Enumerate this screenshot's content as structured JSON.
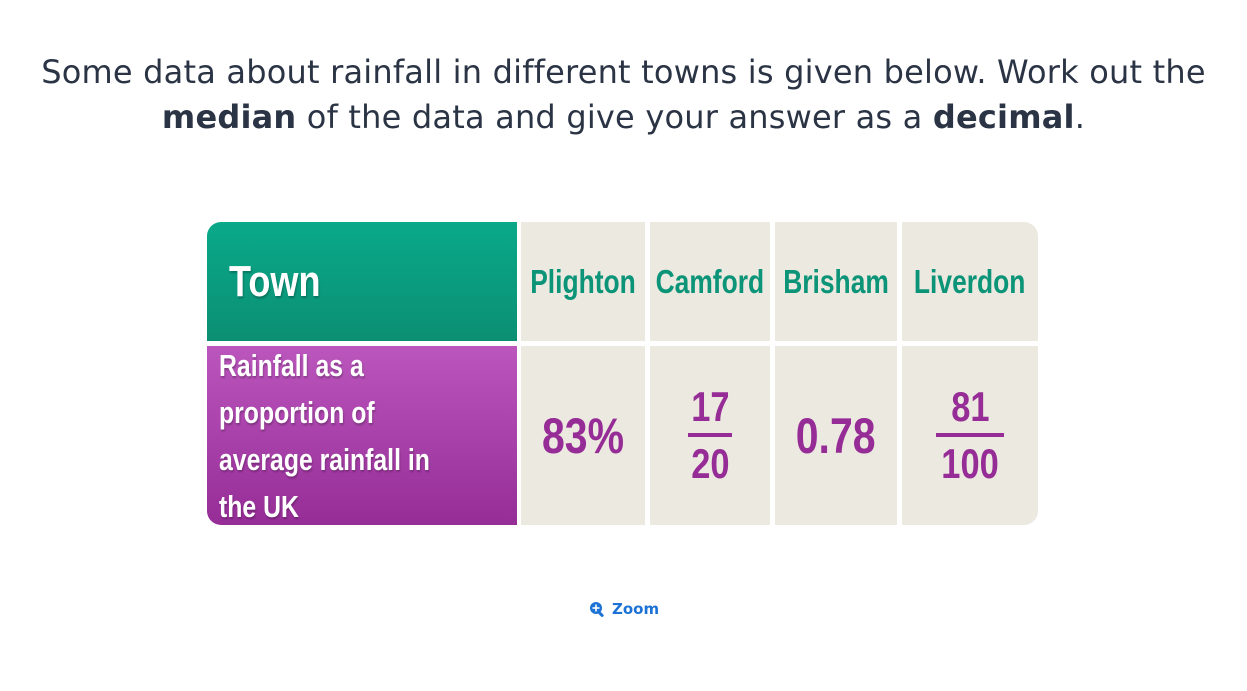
{
  "question": {
    "line1": "Some data about rainfall in different towns is given below. Work out the",
    "line2_bold1": "median",
    "line2_mid": " of the data and give your answer as a ",
    "line2_bold2": "decimal",
    "line2_end": "."
  },
  "table": {
    "header_label": "Town",
    "row_label": "Rainfall as a proportion of average rainfall in the UK",
    "towns": [
      "Plighton",
      "Camford",
      "Brisham",
      "Liverdon"
    ],
    "values": {
      "plighton": "83%",
      "camford_num": "17",
      "camford_den": "20",
      "brisham": "0.78",
      "liverdon_num": "81",
      "liverdon_den": "100"
    }
  },
  "zoom": {
    "label": "Zoom",
    "icon": "zoom-in-icon"
  },
  "colors": {
    "text": "#2b3445",
    "teal": "#0b9478",
    "purple": "#962d97",
    "cell_bg": "#ece9e0",
    "link": "#1d72d6"
  }
}
